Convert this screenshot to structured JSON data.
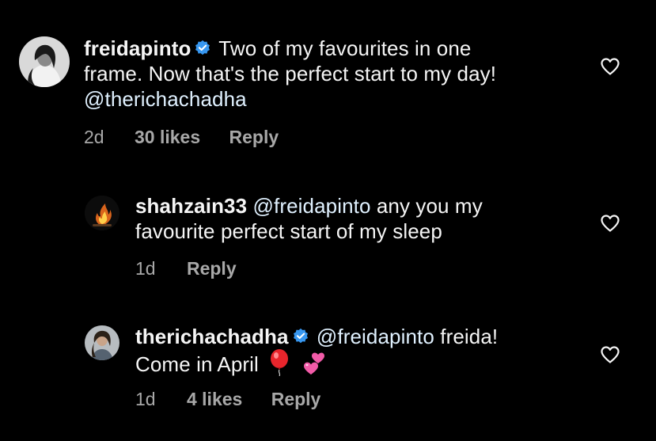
{
  "comments": [
    {
      "username": "freidapinto",
      "verified": true,
      "text_line1": "Two of my favourites in one",
      "text_line2": "frame. Now that's the perfect start to my day!",
      "mention": "@therichachadha",
      "time": "2d",
      "likes": "30 likes",
      "reply": "Reply"
    },
    {
      "username": "shahzain33",
      "verified": false,
      "mention": "@freidapinto",
      "text_line1": "any you my",
      "text_line2": "favourite perfect start of my sleep",
      "time": "1d",
      "reply": "Reply"
    },
    {
      "username": "therichachadha",
      "verified": true,
      "mention": "@freidapinto",
      "text_line1": "freida!",
      "text_line2": "Come in April",
      "emoji_balloon": "balloon-emoji",
      "emoji_hearts": "two-hearts-emoji",
      "time": "1d",
      "likes": "4 likes",
      "reply": "Reply"
    }
  ],
  "icons": {
    "verified": "verified-badge-icon",
    "like": "heart-outline-icon"
  },
  "colors": {
    "background": "#000000",
    "text": "#f5f5f5",
    "meta": "#a8a8a8",
    "verified": "#3797f0"
  }
}
